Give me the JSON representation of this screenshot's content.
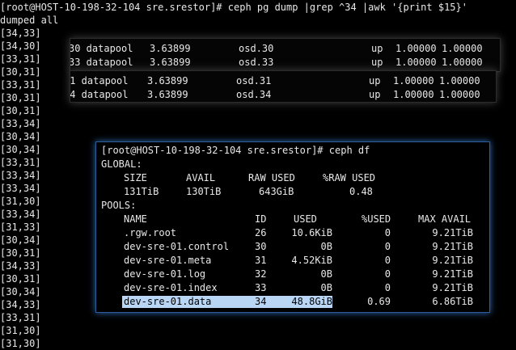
{
  "terminal": {
    "prompt": "[root@HOST-10-198-32-104 sre.srestor]# ",
    "command": "ceph pg dump |grep ^34 |awk '{print $15}'",
    "status": "dumped all",
    "pgs": [
      "[34,33]",
      "[34,30]",
      "[33,31]",
      "[30,31]",
      "[33,31]",
      "[30,31]",
      "[30,31]",
      "[33,34]",
      "[30,34]",
      "[30,34]",
      "[33,31]",
      "[33,34]",
      "[33,34]",
      "[31,30]",
      "[33,34]",
      "[31,33]",
      "[30,34]",
      "[30,31]",
      "[34,33]",
      "[30,31]",
      "[30,34]",
      "[34,33]",
      "[33,31]",
      "[31,30]",
      "[31,30]"
    ]
  },
  "osd_panels": [
    {
      "rows": [
        [
          "30 datapool",
          "3.63899",
          "osd.30",
          "up",
          "1.00000",
          "1.00000"
        ],
        [
          "33 datapool",
          "3.63899",
          "osd.33",
          "up",
          "1.00000",
          "1.00000"
        ]
      ]
    },
    {
      "rows": [
        [
          "31 datapool",
          "3.63899",
          "osd.31",
          "up",
          "1.00000",
          "1.00000"
        ],
        [
          "34 datapool",
          "3.63899",
          "osd.34",
          "up",
          "1.00000",
          "1.00000"
        ]
      ]
    }
  ],
  "ceph_df": {
    "prompt": "[root@HOST-10-198-32-104 sre.srestor]# ",
    "command": "ceph df",
    "global_label": "GLOBAL:",
    "global_headers": [
      "SIZE",
      "AVAIL",
      "RAW USED",
      "%RAW USED"
    ],
    "global_values": [
      "131TiB",
      "130TiB",
      "643GiB",
      "0.48"
    ],
    "pools_label": "POOLS:",
    "pool_headers": [
      "NAME",
      "ID",
      "USED",
      "%USED",
      "MAX AVAIL"
    ],
    "pools": [
      [
        ".rgw.root",
        "26",
        "10.6KiB",
        "0",
        "9.21TiB"
      ],
      [
        "dev-sre-01.control",
        "30",
        "0B",
        "0",
        "9.21TiB"
      ],
      [
        "dev-sre-01.meta",
        "31",
        "4.52KiB",
        "0",
        "9.21TiB"
      ],
      [
        "dev-sre-01.log",
        "32",
        "0B",
        "0",
        "9.21TiB"
      ],
      [
        "dev-sre-01.index",
        "33",
        "0B",
        "0",
        "9.21TiB"
      ],
      [
        "dev-sre-01.data",
        "34",
        "48.8GiB",
        "0.69",
        "6.86TiB"
      ]
    ],
    "highlighted_pool_index": 5
  }
}
